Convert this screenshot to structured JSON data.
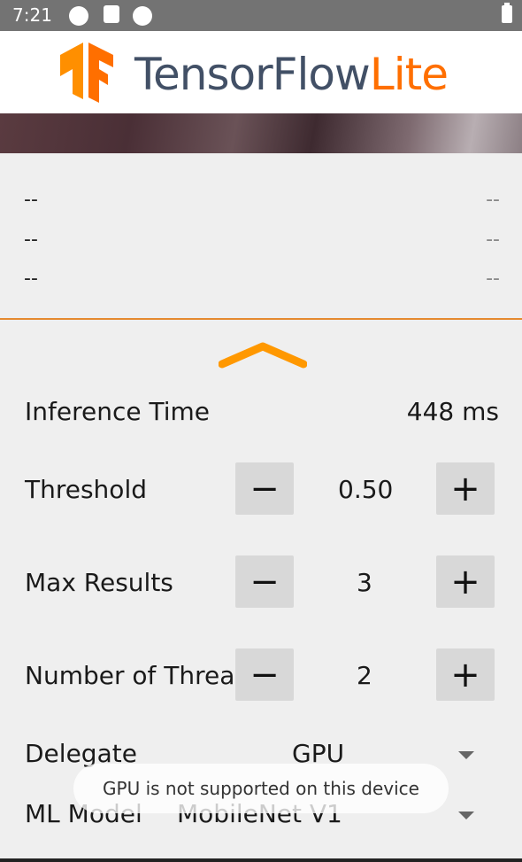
{
  "status_bar": {
    "time": "7:21"
  },
  "toolbar": {
    "logo_text_main": "TensorFlow",
    "logo_text_accent": "Lite",
    "accent_color": "#ff6f00",
    "brand_color": "#425066"
  },
  "results": [
    {
      "label": "--",
      "score": "--"
    },
    {
      "label": "--",
      "score": "--"
    },
    {
      "label": "--",
      "score": "--"
    }
  ],
  "inference": {
    "label": "Inference Time",
    "value": "448 ms"
  },
  "threshold": {
    "label": "Threshold",
    "value": "0.50",
    "minus": "−",
    "plus": "+"
  },
  "max_results": {
    "label": "Max Results",
    "value": "3",
    "minus": "−",
    "plus": "+"
  },
  "threads": {
    "label": "Number of Threads",
    "value": "2",
    "minus": "−",
    "plus": "+"
  },
  "delegate": {
    "label": "Delegate",
    "selected": "GPU"
  },
  "ml_model": {
    "label": "ML Model",
    "selected": "MobileNet V1"
  },
  "toast": {
    "message": "GPU is not supported on this device"
  }
}
